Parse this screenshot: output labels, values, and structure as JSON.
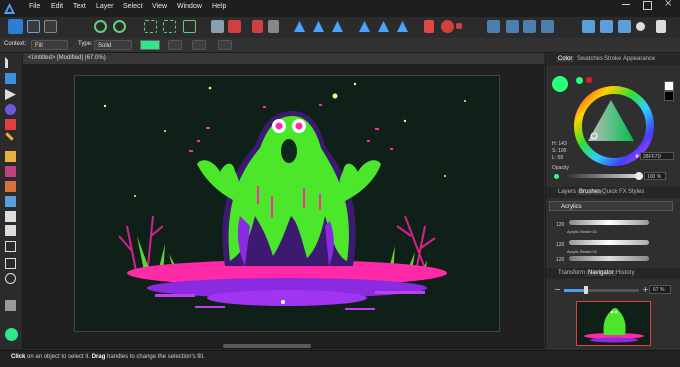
{
  "menu": {
    "items": [
      "File",
      "Edit",
      "Text",
      "Layer",
      "Select",
      "View",
      "Window",
      "Help"
    ]
  },
  "context_bar": {
    "context_label": "Context:",
    "context_value": "Fill",
    "type_label": "Type:",
    "type_value": "Solid",
    "fill_color": "#2EE88A"
  },
  "document": {
    "tab_title": "<Untitled> [Modified] (67.0%)"
  },
  "color_panel": {
    "tabs": [
      "Color",
      "Swatches",
      "Stroke",
      "Appearance"
    ],
    "active_tab": "Color",
    "current_color": "#28FF7D",
    "h_label": "H: 143",
    "s_label": "S: 100",
    "l_label": "L: 58",
    "hex_value": "28FF7D",
    "opacity_label": "Opacity",
    "opacity_value": "100 %"
  },
  "brushes_panel": {
    "tabs": [
      "Layers",
      "Brushes",
      "Quick FX",
      "Styles"
    ],
    "active_tab": "Brushes",
    "category": "Acrylics",
    "brushes": [
      {
        "size": "120",
        "name": "Acrylic Stroke 01"
      },
      {
        "size": "120",
        "name": "Acrylic Stroke 02"
      },
      {
        "size": "120",
        "name": ""
      }
    ]
  },
  "navigator_panel": {
    "tabs": [
      "Transform",
      "Navigator",
      "History"
    ],
    "active_tab": "Navigator",
    "zoom_value": "67 %"
  },
  "status": {
    "click_word": "Click",
    "text1": " on an object to select it. ",
    "drag_word": "Drag",
    "text2": " handles to change the selection's fill."
  },
  "colors": {
    "accent": "#28FF7D",
    "canvas_bg": "#0F2018",
    "slime_green": "#4CE62A",
    "magenta": "#FF2AA8",
    "purple": "#8A2BE2"
  }
}
